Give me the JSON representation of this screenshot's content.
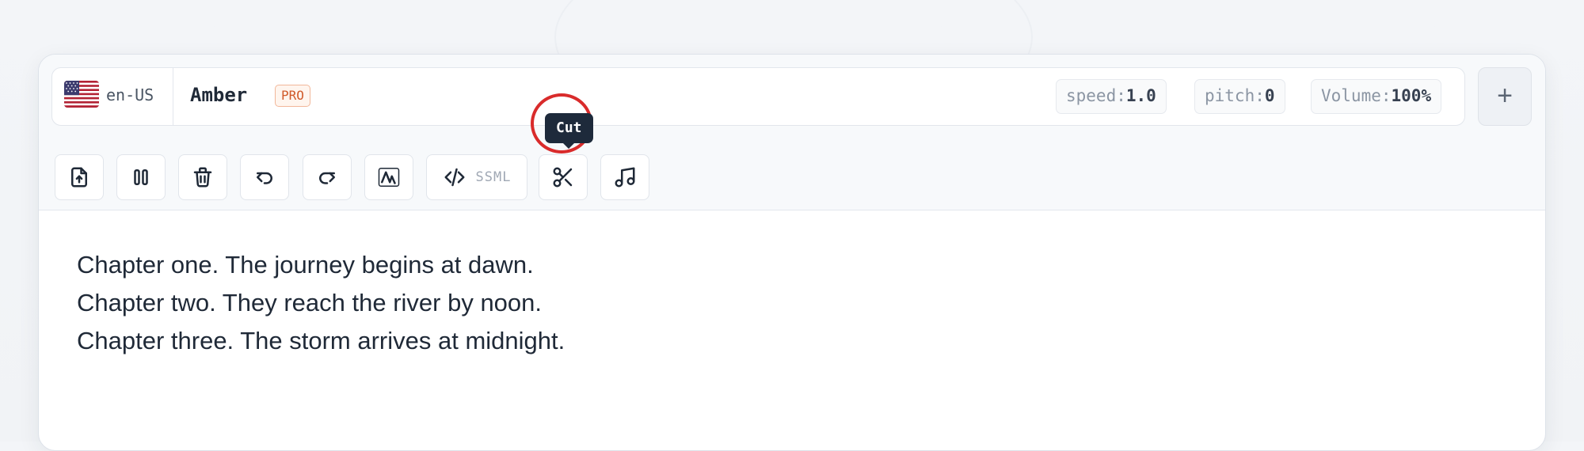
{
  "voice": {
    "locale": "en-US",
    "name": "Amber",
    "badge": "PRO"
  },
  "params": [
    {
      "key": "speed:",
      "value": "1.0"
    },
    {
      "key": "pitch:",
      "value": "0"
    },
    {
      "key": "Volume:",
      "value": "100%"
    }
  ],
  "add_button": "+",
  "toolbar": {
    "buttons": [
      "upload-icon",
      "pause-icon",
      "trash-icon",
      "undo-icon",
      "redo-icon",
      "waveform-icon",
      "code-icon",
      "scissors-icon",
      "music-note-icon"
    ],
    "ssml_label": "SSML",
    "active_tooltip": "Cut"
  },
  "editor": {
    "lines": [
      "Chapter one. The journey begins at dawn.",
      "Chapter two. They reach the river by noon.",
      "Chapter three. The storm arrives at midnight."
    ]
  },
  "colors": {
    "highlight_ring": "#d92b2b",
    "badge": "#d05a2a",
    "tooltip_bg": "#1e2a3b"
  }
}
